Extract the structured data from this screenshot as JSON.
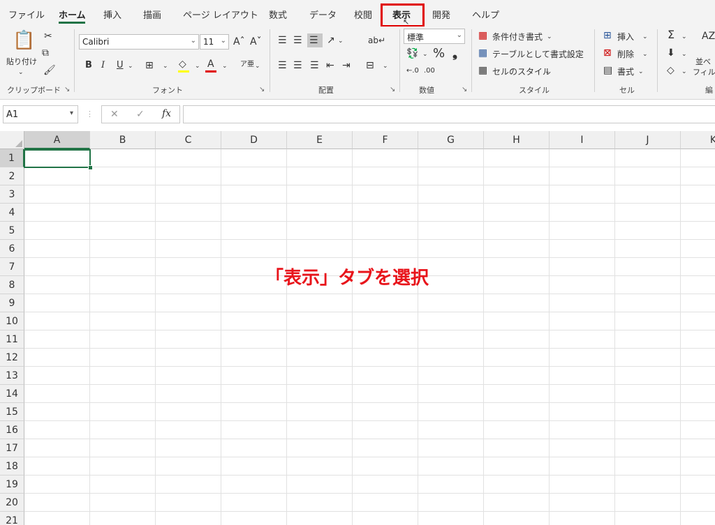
{
  "tabs": [
    {
      "label": "ファイル"
    },
    {
      "label": "ホーム"
    },
    {
      "label": "挿入"
    },
    {
      "label": "描画"
    },
    {
      "label": "ページ レイアウト"
    },
    {
      "label": "数式"
    },
    {
      "label": "データ"
    },
    {
      "label": "校閲"
    },
    {
      "label": "表示"
    },
    {
      "label": "開発"
    },
    {
      "label": "ヘルプ"
    }
  ],
  "ribbon": {
    "clipboard": {
      "paste_label": "貼り付け",
      "group_label": "クリップボード"
    },
    "font": {
      "font_name": "Calibri",
      "font_size": "11",
      "group_label": "フォント",
      "bold": "B",
      "italic": "I",
      "underline": "U",
      "font_color_glyph": "A"
    },
    "alignment": {
      "group_label": "配置"
    },
    "number": {
      "format": "標準",
      "percent": "%",
      "comma": "❟",
      "group_label": "数値"
    },
    "styles": {
      "conditional": "条件付き書式",
      "table": "テーブルとして書式設定",
      "cell_styles": "セルのスタイル",
      "group_label": "スタイル"
    },
    "cells": {
      "insert": "挿入",
      "delete": "削除",
      "format": "書式",
      "group_label": "セル"
    },
    "editing": {
      "sort": "並べ",
      "filter": "フィルタ",
      "group_label": "編"
    }
  },
  "formula_bar": {
    "name_box": "A1",
    "fx": "fx",
    "value": ""
  },
  "grid": {
    "columns": [
      "A",
      "B",
      "C",
      "D",
      "E",
      "F",
      "G",
      "H",
      "I",
      "J",
      "K"
    ],
    "rows": [
      "1",
      "2",
      "3",
      "4",
      "5",
      "6",
      "7",
      "8",
      "9",
      "10",
      "11",
      "12",
      "13",
      "14",
      "15",
      "16",
      "17",
      "18",
      "19",
      "20",
      "21"
    ],
    "selected_cell": "A1"
  },
  "annotation": "「表示」タブを選択",
  "colors": {
    "accent": "#217346",
    "highlight": "#e00000",
    "annotation": "#e8141b"
  }
}
